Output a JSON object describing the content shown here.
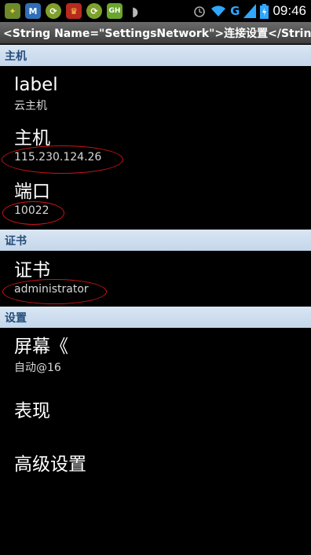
{
  "status_bar": {
    "time": "09:46",
    "network": "G",
    "notification_icons": [
      "app-icon",
      "maxthon-icon",
      "app-icon",
      "game-icon",
      "app-icon",
      "game-icon",
      "android-icon"
    ]
  },
  "title_bar": {
    "title": "<String Name=\"SettingsNetwork\">连接设置</String>"
  },
  "sections": {
    "host": "主机",
    "cert": "证书",
    "settings": "设置"
  },
  "items": {
    "label": {
      "title": "label",
      "summary": "云主机"
    },
    "host": {
      "title": "主机",
      "summary": "115.230.124.26"
    },
    "port": {
      "title": "端口",
      "summary": "10022"
    },
    "cert": {
      "title": "证书",
      "summary": "administrator"
    },
    "screen": {
      "title": "屏幕《",
      "summary": "自动@16"
    },
    "perf": {
      "title": "表现"
    },
    "advanced": {
      "title": "高级设置"
    }
  },
  "colors": {
    "section_bg": "#c8d9ec",
    "section_text": "#234c7a",
    "annotation": "#d01414"
  }
}
